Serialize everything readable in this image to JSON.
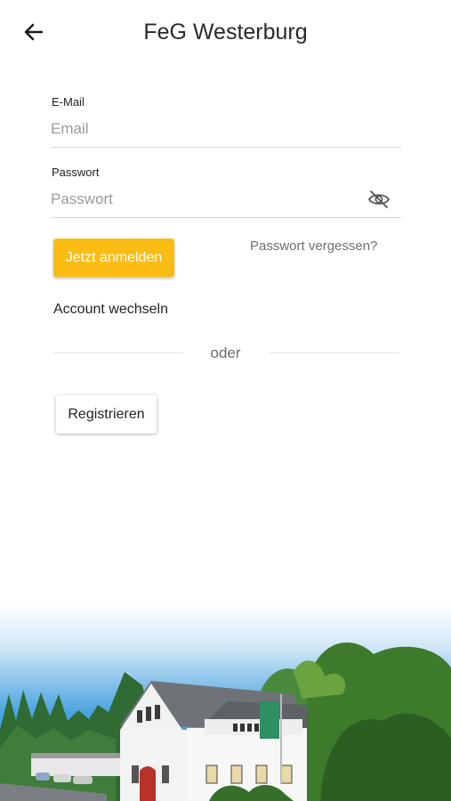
{
  "header": {
    "title": "FeG Westerburg",
    "back_icon": "arrow-left-icon"
  },
  "form": {
    "email": {
      "label": "E-Mail",
      "placeholder": "Email",
      "value": ""
    },
    "password": {
      "label": "Passwort",
      "placeholder": "Passwort",
      "value": "",
      "toggle_icon": "eye-off-icon"
    },
    "login_label": "Jetzt anmelden",
    "forgot_label": "Passwort vergessen?",
    "switch_account_label": "Account wechseln",
    "divider_label": "oder",
    "register_label": "Registrieren"
  },
  "colors": {
    "accent": "#fbbc14",
    "sky": "#4aa3e0"
  },
  "footer_image": {
    "icon": "church-building-photo"
  }
}
